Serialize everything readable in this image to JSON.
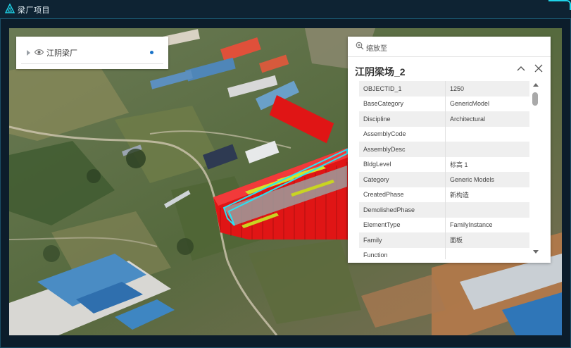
{
  "app": {
    "title": "梁厂项目"
  },
  "layers": {
    "items": [
      {
        "name": "江阴梁厂"
      }
    ]
  },
  "popup": {
    "zoom_label": "缩放至",
    "title": "江阴梁场_2",
    "attributes": [
      {
        "key": "OBJECTID_1",
        "value": "1250"
      },
      {
        "key": "BaseCategory",
        "value": "GenericModel"
      },
      {
        "key": "Discipline",
        "value": "Architectural"
      },
      {
        "key": "AssemblyCode",
        "value": ""
      },
      {
        "key": "AssemblyDesc",
        "value": ""
      },
      {
        "key": "BldgLevel",
        "value": "标高 1"
      },
      {
        "key": "Category",
        "value": "Generic Models"
      },
      {
        "key": "CreatedPhase",
        "value": "新构造"
      },
      {
        "key": "DemolishedPhase",
        "value": ""
      },
      {
        "key": "ElementType",
        "value": "FamilyInstance"
      },
      {
        "key": "Family",
        "value": "面板"
      },
      {
        "key": "Function",
        "value": ""
      }
    ]
  },
  "icons": {
    "app": "triangle-logo-icon",
    "visibility": "eye-icon",
    "zoom": "zoom-in-icon",
    "collapse": "chevron-up-icon",
    "close": "close-icon"
  },
  "colors": {
    "header_bg": "#0e2333",
    "accent": "#1fd3e8",
    "building_red": "#e01515",
    "highlight": "#27e3f5"
  }
}
